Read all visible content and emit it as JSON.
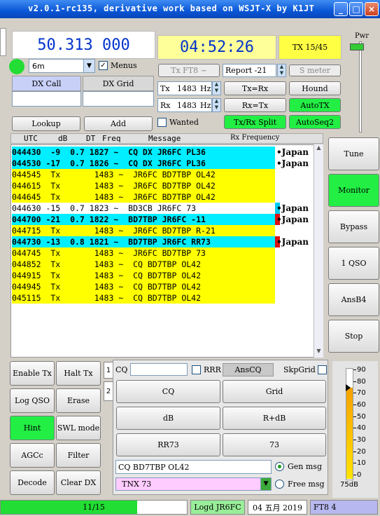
{
  "window": {
    "title": "v2.0.1-rc135, derivative work based on WSJT-X by K1JT"
  },
  "freq_display": "50.313 000",
  "time_display": "04:52:26",
  "tx_period_label": "TX 15/45",
  "band": {
    "value": "6m"
  },
  "menus_label": "Menus",
  "pwr_label": "Pwr",
  "dx_call": {
    "header": "DX Call",
    "value": ""
  },
  "dx_grid": {
    "header": "DX Grid",
    "value": ""
  },
  "lookup_label": "Lookup",
  "add_label": "Add",
  "mode_button": "Tx FT8 ~",
  "report": {
    "value": "Report -21"
  },
  "smeter_label": "S meter",
  "tx_freq": {
    "label": "Tx",
    "value": "1483",
    "unit": "Hz"
  },
  "rx_freq": {
    "label": "Rx",
    "value": "1483",
    "unit": "Hz"
  },
  "tx_eq_rx": "Tx=Rx",
  "rx_eq_tx": "Rx=Tx",
  "hound_label": "Hound",
  "autotx_label": "AutoTX",
  "wanted_label": "Wanted",
  "txrx_split_label": "Tx/Rx Split",
  "autoseq2_label": "AutoSeq2",
  "rx_frequency_label": "Rx Frequency",
  "columns": [
    "UTC",
    "dB",
    "DT",
    "Freq",
    "Message"
  ],
  "decodes": [
    {
      "kind": "cq",
      "text": "044430  -9  0.7 1827 ~  CQ DX JR6FC PL36",
      "country": "•Japan",
      "mark": ""
    },
    {
      "kind": "cq",
      "text": "044530 -17  0.7 1826 ~  CQ DX JR6FC PL36",
      "country": "•Japan",
      "mark": ""
    },
    {
      "kind": "tx",
      "text": "044545  Tx       1483 ~  JR6FC BD7TBP OL42",
      "country": "",
      "mark": ""
    },
    {
      "kind": "tx",
      "text": "044615  Tx       1483 ~  JR6FC BD7TBP OL42",
      "country": "",
      "mark": ""
    },
    {
      "kind": "tx",
      "text": "044645  Tx       1483 ~  JR6FC BD7TBP OL42",
      "country": "",
      "mark": ""
    },
    {
      "kind": "rx",
      "text": "044630 -15  0.7 1823 ~  BD3CB JR6FC 73",
      "country": "•Japan",
      "mark": "#00ccee"
    },
    {
      "kind": "me",
      "text": "044700 -21  0.7 1822 ~  BD7TBP JR6FC -11",
      "country": "•Japan",
      "mark": "#dd1111"
    },
    {
      "kind": "tx",
      "text": "044715  Tx       1483 ~  JR6FC BD7TBP R-21",
      "country": "",
      "mark": ""
    },
    {
      "kind": "me",
      "text": "044730 -13  0.8 1821 ~  BD7TBP JR6FC RR73",
      "country": "•Japan",
      "mark": "#dd1111"
    },
    {
      "kind": "tx",
      "text": "044745  Tx       1483 ~  JR6FC BD7TBP 73",
      "country": "",
      "mark": ""
    },
    {
      "kind": "tx",
      "text": "044852  Tx       1483 ~  CQ BD7TBP OL42",
      "country": "",
      "mark": ""
    },
    {
      "kind": "tx",
      "text": "044915  Tx       1483 ~  CQ BD7TBP OL42",
      "country": "",
      "mark": ""
    },
    {
      "kind": "tx",
      "text": "044945  Tx       1483 ~  CQ BD7TBP OL42",
      "country": "",
      "mark": ""
    },
    {
      "kind": "tx",
      "text": "045115  Tx       1483 ~  CQ BD7TBP OL42",
      "country": "",
      "mark": ""
    }
  ],
  "right_buttons": [
    "Tune",
    "Monitor",
    "Bypass",
    "1 QSO",
    "AnsB4",
    "Stop"
  ],
  "left_buttons": {
    "enable_tx": "Enable Tx",
    "halt_tx": "Halt Tx",
    "log_qso": "Log QSO",
    "erase": "Erase",
    "hint": "Hint",
    "swl": "SWL mode",
    "agcc": "AGCc",
    "filter": "Filter",
    "decode": "Decode",
    "clear_dx": "Clear DX"
  },
  "tabs": [
    "1",
    "2"
  ],
  "msg_panel": {
    "cq_label": "CQ",
    "cq_value": "",
    "rrr_label": "RRR",
    "anscq_label": "AnsCQ",
    "skpgrid_label": "SkpGrid",
    "buttons": [
      "CQ",
      "Grid",
      "dB",
      "R+dB",
      "RR73",
      "73"
    ],
    "gen_msg_value": "CQ BD7TBP OL42",
    "gen_msg_label": "Gen msg",
    "free_msg_value": "TNX 73",
    "free_msg_label": "Free msg"
  },
  "meter": {
    "ticks": [
      "90",
      "80",
      "70",
      "60",
      "50",
      "40",
      "30",
      "20",
      "10",
      "0"
    ],
    "value_label": "75dB",
    "level": 75
  },
  "status": {
    "progress_text": "11/15",
    "progress": 0.733,
    "logged": "Logd JR6FC",
    "date": "04 五月 2019",
    "mode": "FT8  4"
  },
  "colors": {
    "green": "#22ee44",
    "cyan": "#00eeff",
    "yellow": "#ffff00",
    "freq_blue": "#0033cc"
  }
}
